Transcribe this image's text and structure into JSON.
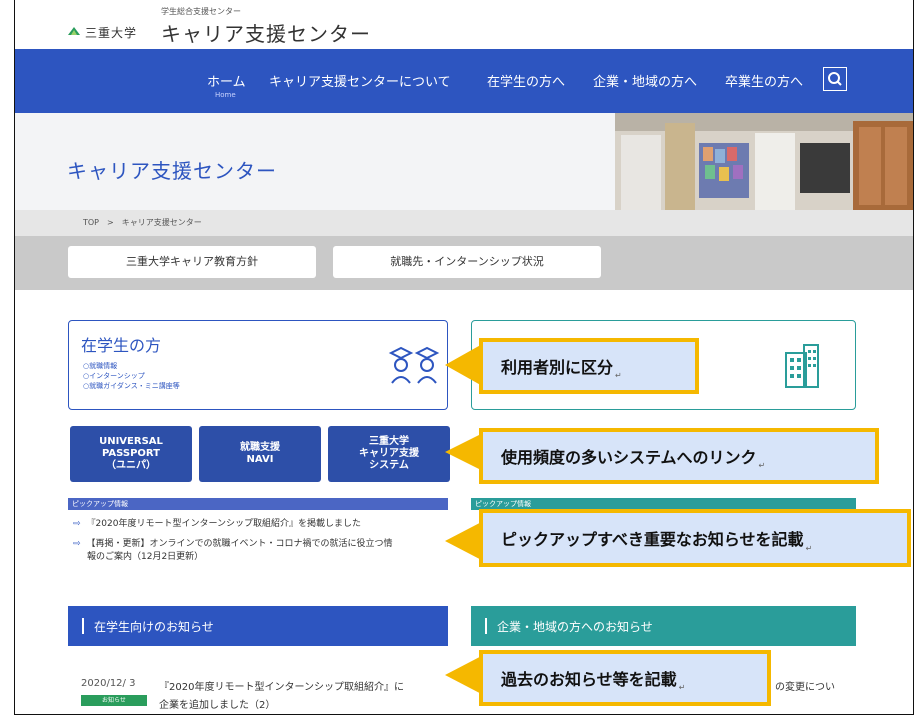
{
  "header": {
    "university": "三重大学",
    "subtitle": "学生総合支援センター",
    "title": "キャリア支援センター"
  },
  "nav": {
    "items": [
      "ホーム",
      "キャリア支援センターについて",
      "在学生の方へ",
      "企業・地域の方へ",
      "卒業生の方へ"
    ],
    "home_sub": "Home"
  },
  "hero": {
    "title": "キャリア支援センター"
  },
  "breadcrumb": {
    "text": "TOP　>　キャリア支援センター"
  },
  "links": [
    "三重大学キャリア教育方針",
    "就職先・インターンシップ状況"
  ],
  "student_card": {
    "title": "在学生の方",
    "items": [
      "○就職情報",
      "○インターンシップ",
      "○就職ガイダンス・ミニ講座等"
    ]
  },
  "systems": {
    "universal_passport": {
      "line1": "UNIVERSAL",
      "line2": "PASSPORT",
      "line3": "（ユニパ）"
    },
    "navi": {
      "line1": "就職支援",
      "line2": "NAVI"
    },
    "career_system": {
      "line1": "三重大学",
      "line2": "キャリア支援",
      "line3": "システム"
    }
  },
  "pickup": {
    "left_label": "ピックアップ情報",
    "right_label": "ピックアップ情報",
    "items": [
      "『2020年度リモート型インターンシップ取組紹介』を掲載しました",
      "【再掲・更新】オンラインでの就職イベント・コロナ禍での就活に役立つ情",
      "報のご案内（12月2日更新）"
    ]
  },
  "news": {
    "student_heading": "在学生向けのお知らせ",
    "company_heading": "企業・地域の方へのお知らせ",
    "date": "2020/12/ 3",
    "title_line1": "『2020年度リモート型インターンシップ取組紹介』に",
    "title_line2": "企業を追加しました（2）",
    "badge": "お知らせ",
    "right_fragment": "の変更につい"
  },
  "callouts": {
    "c1": "利用者別に区分",
    "c2": "使用頻度の多いシステムへのリンク",
    "c3": "ピックアップすべき重要なお知らせを記載",
    "c4": "過去のお知らせ等を記載",
    "mark": "↵"
  },
  "colors": {
    "nav_blue": "#2d55c0",
    "teal": "#2a9d9a",
    "callout_border": "#f5b800",
    "callout_bg": "#d7e4f9"
  }
}
